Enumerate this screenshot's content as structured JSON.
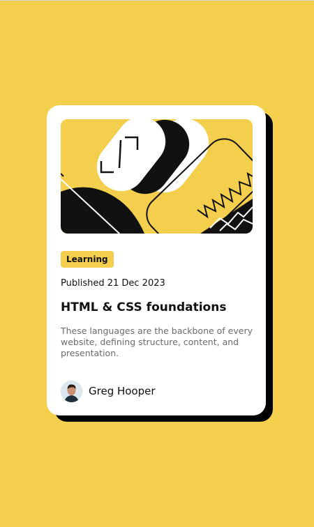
{
  "card": {
    "tag": "Learning",
    "published": "Published 21 Dec 2023",
    "title": "HTML & CSS foundations",
    "description": "These languages are the backbone of every website, defining structure, content, and presentation.",
    "author_name": "Greg Hooper"
  },
  "icons": {
    "hero": "abstract-illustration",
    "avatar": "person-avatar"
  },
  "colors": {
    "background": "#f4ce4d",
    "card": "#ffffff",
    "shadow": "#000000",
    "tag_background": "#f4ce4d",
    "text_primary": "#111111",
    "text_secondary": "#6b6b6b"
  }
}
